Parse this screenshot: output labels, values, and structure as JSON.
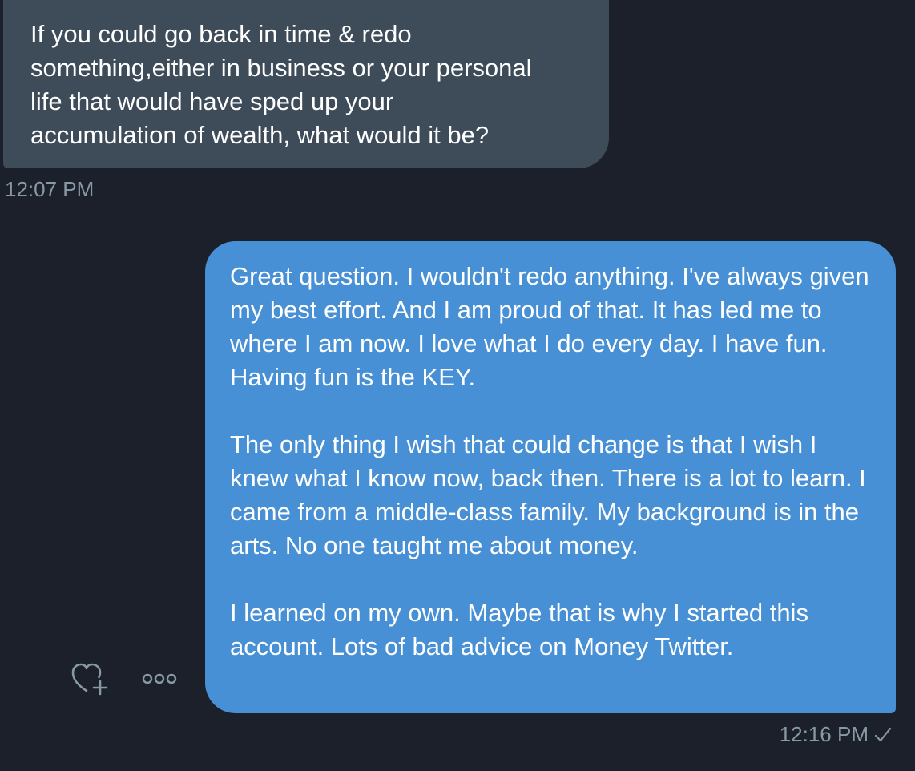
{
  "conversation": {
    "received": {
      "text": "If you could go back in time & redo\nsomething,either in business or your personal\nlife that would have sped up your\naccumulation of wealth, what would it be?",
      "timestamp": "12:07 PM"
    },
    "sent": {
      "paragraphs": [
        "Great question. I wouldn't redo anything. I've always given my best effort. And I am proud of that. It has led me to where I am now. I love what I do every day. I have fun. Having fun is the KEY.",
        "The only thing I wish that could change is that I wish I knew what I know now, back then. There is a lot to learn. I came from a middle-class family. My background is in the arts. No one taught me about money.",
        "I learned on my own. Maybe that is why I started this account. Lots of bad advice on Money Twitter."
      ],
      "timestamp": "12:16 PM",
      "status_icon": "check-icon"
    },
    "actions": {
      "react_icon": "heart-plus-icon",
      "more_icon": "more-options-icon"
    }
  },
  "colors": {
    "background": "#1b202a",
    "received_bubble": "#3e4b59",
    "sent_bubble": "#4890d5",
    "timestamp": "#8899a6",
    "icon": "#8899a6"
  }
}
